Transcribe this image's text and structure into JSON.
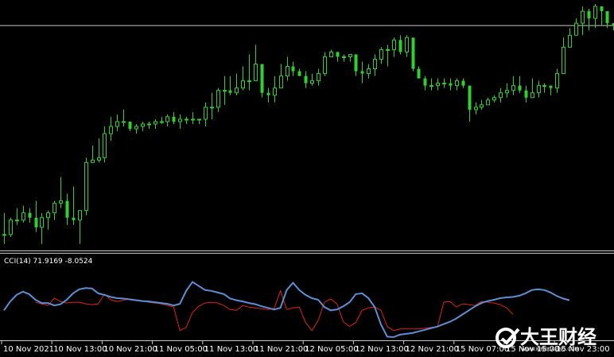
{
  "colors": {
    "background": "#000000",
    "candle": "#2fd12f",
    "axis_frame": "#c8c8c8",
    "cci_main": "#5b8fd6",
    "cci_signal": "#e02020",
    "text": "#ffffff"
  },
  "watermark": {
    "text": "大王财经",
    "sub": "WWW.KINGCAIJING.COM",
    "icon": "c-check-logo-icon"
  },
  "chart_data": [
    {
      "type": "candlestick",
      "title": "",
      "price_range": [
        0,
        100
      ],
      "price_line": 91,
      "candles": [
        [
          4,
          4,
          13,
          0
        ],
        [
          4,
          10,
          11,
          3
        ],
        [
          10,
          10,
          15,
          8
        ],
        [
          10,
          13,
          16,
          9
        ],
        [
          13,
          11,
          15,
          9
        ],
        [
          11,
          7,
          18,
          5
        ],
        [
          7,
          11,
          13,
          0
        ],
        [
          11,
          13,
          14,
          6
        ],
        [
          13,
          17,
          18,
          10
        ],
        [
          17,
          18,
          28,
          15
        ],
        [
          18,
          11,
          21,
          8
        ],
        [
          11,
          10,
          24,
          8
        ],
        [
          10,
          14,
          14,
          0
        ],
        [
          14,
          34,
          36,
          12
        ],
        [
          34,
          35,
          41,
          34
        ],
        [
          35,
          36,
          44,
          34
        ],
        [
          36,
          46,
          49,
          34
        ],
        [
          46,
          49,
          53,
          43
        ],
        [
          49,
          51,
          54,
          47
        ],
        [
          51,
          51,
          56,
          49
        ],
        [
          51,
          48,
          50,
          47
        ],
        [
          48,
          49,
          50,
          46
        ],
        [
          49,
          50,
          51,
          47
        ],
        [
          50,
          50,
          51,
          48
        ],
        [
          50,
          51,
          52,
          48
        ],
        [
          51,
          51,
          53,
          50
        ],
        [
          51,
          53,
          54,
          49
        ],
        [
          53,
          51,
          55,
          50
        ],
        [
          51,
          52,
          54,
          48
        ],
        [
          52,
          52,
          53,
          50
        ],
        [
          52,
          52,
          55,
          50
        ],
        [
          52,
          52,
          52,
          50
        ],
        [
          52,
          57,
          59,
          49
        ],
        [
          57,
          57,
          63,
          52
        ],
        [
          57,
          64,
          65,
          55
        ],
        [
          64,
          64,
          70,
          58
        ],
        [
          64,
          63,
          70,
          62
        ],
        [
          63,
          65,
          71,
          62
        ],
        [
          65,
          68,
          74,
          64
        ],
        [
          68,
          68,
          79,
          64
        ],
        [
          68,
          75,
          83,
          70
        ],
        [
          75,
          63,
          75,
          61
        ],
        [
          63,
          62,
          65,
          59
        ],
        [
          62,
          65,
          70,
          59
        ],
        [
          65,
          70,
          75,
          67
        ],
        [
          70,
          74,
          78,
          68
        ],
        [
          74,
          72,
          76,
          70
        ],
        [
          72,
          70,
          73,
          70
        ],
        [
          70,
          67,
          72,
          65
        ],
        [
          67,
          68,
          71,
          66
        ],
        [
          68,
          71,
          73,
          66
        ],
        [
          71,
          78,
          80,
          70
        ],
        [
          78,
          80,
          81,
          78
        ],
        [
          80,
          78,
          80,
          76
        ],
        [
          78,
          78,
          79,
          76
        ],
        [
          78,
          79,
          79,
          76
        ],
        [
          79,
          72,
          79,
          70
        ],
        [
          72,
          71,
          76,
          67
        ],
        [
          71,
          73,
          75,
          69
        ],
        [
          73,
          77,
          79,
          70
        ],
        [
          77,
          81,
          82,
          75
        ],
        [
          81,
          81,
          83,
          74
        ],
        [
          81,
          85,
          86,
          78
        ],
        [
          85,
          80,
          87,
          79
        ],
        [
          80,
          86,
          87,
          78
        ],
        [
          86,
          73,
          84,
          72
        ],
        [
          73,
          69,
          74,
          69
        ],
        [
          69,
          66,
          70,
          64
        ],
        [
          66,
          66,
          69,
          64
        ],
        [
          66,
          67,
          69,
          64
        ],
        [
          67,
          67,
          69,
          65
        ],
        [
          67,
          66,
          69,
          64
        ],
        [
          66,
          68,
          69,
          64
        ],
        [
          68,
          66,
          69,
          65
        ],
        [
          66,
          56,
          66,
          51
        ],
        [
          56,
          57,
          59,
          54
        ],
        [
          57,
          58,
          60,
          56
        ],
        [
          58,
          60,
          61,
          58
        ],
        [
          60,
          61,
          62,
          59
        ],
        [
          61,
          63,
          65,
          59
        ],
        [
          63,
          64,
          67,
          61
        ],
        [
          64,
          66,
          70,
          62
        ],
        [
          66,
          64,
          70,
          63
        ],
        [
          64,
          61,
          66,
          59
        ],
        [
          61,
          63,
          69,
          61
        ],
        [
          63,
          66,
          68,
          61
        ],
        [
          66,
          66,
          67,
          63
        ],
        [
          66,
          65,
          66,
          62
        ],
        [
          65,
          71,
          73,
          63
        ],
        [
          71,
          82,
          86,
          76
        ],
        [
          82,
          87,
          90,
          83
        ],
        [
          87,
          92,
          94,
          87
        ],
        [
          92,
          97,
          99,
          87
        ],
        [
          97,
          94,
          98,
          89
        ],
        [
          94,
          99,
          100,
          90
        ],
        [
          99,
          97,
          99,
          91
        ],
        [
          97,
          92,
          95,
          90
        ],
        [
          92,
          91,
          92,
          89
        ]
      ]
    },
    {
      "type": "line",
      "title": "CCI(14) 71.9169 -8.0524",
      "ylim": [
        -100,
        100
      ],
      "series": [
        {
          "role": "main",
          "values": [
            -30,
            -8,
            8,
            16,
            10,
            -4,
            -12,
            -12,
            -18,
            -15,
            -4,
            12,
            22,
            25,
            24,
            12,
            8,
            3,
            0,
            -1,
            -3,
            -5,
            -7,
            -8,
            -10,
            -12,
            -14,
            -18,
            -14,
            18,
            40,
            30,
            20,
            18,
            14,
            10,
            -1,
            -5,
            -8,
            -12,
            -15,
            -20,
            -24,
            -28,
            -24,
            20,
            38,
            20,
            8,
            0,
            -4,
            -22,
            -30,
            -28,
            -20,
            -10,
            10,
            12,
            0,
            -22,
            -65,
            -95,
            -96,
            -90,
            -88,
            -86,
            -82,
            -78,
            -74,
            -70,
            -64,
            -58,
            -50,
            -40,
            -30,
            -20,
            -12,
            -7,
            -4,
            0,
            2,
            3,
            6,
            12,
            20,
            22,
            20,
            14,
            5,
            -1,
            -5
          ],
          "x_start": 0
        },
        {
          "role": "signal",
          "values": [
            -10,
            -14,
            -18,
            0,
            -8,
            -12,
            -10,
            -10,
            -14,
            -16,
            -14,
            10,
            -4,
            -8,
            -5,
            -2,
            -4,
            -6,
            -10,
            -12,
            -14,
            -18,
            -22,
            -80,
            -72,
            -35,
            -20,
            -12,
            -10,
            -12,
            -18,
            -28,
            -30,
            -18,
            -22,
            -24,
            -26,
            -28,
            -25,
            18,
            -28,
            -24,
            -22,
            -60,
            -80,
            -55,
            -10,
            -2,
            -14,
            -58,
            -70,
            -60,
            -30,
            -24,
            -22,
            -30,
            -70,
            -80,
            -76,
            -76,
            -76,
            -76,
            -74,
            -72,
            -70,
            -10,
            -8,
            -22,
            -14,
            -16,
            -18,
            -8,
            -10,
            -12,
            -16,
            -24,
            -40
          ],
          "x_start": 5
        }
      ]
    }
  ],
  "x_axis": {
    "tick_labels": [
      "10 Nov 2021",
      "10 Nov 13:00",
      "10 Nov 21:00",
      "11 Nov 05:00",
      "11 Nov 13:00",
      "11 Nov 21:00",
      "12 Nov 05:00",
      "12 Nov 13:00",
      "12 Nov 21:00",
      "15 Nov 07:00",
      "15 Nov 15:00",
      "15 Nov 23:00"
    ],
    "tick_candle_index": [
      0,
      8,
      16,
      24,
      32,
      40,
      48,
      56,
      64,
      72,
      80,
      88
    ]
  }
}
